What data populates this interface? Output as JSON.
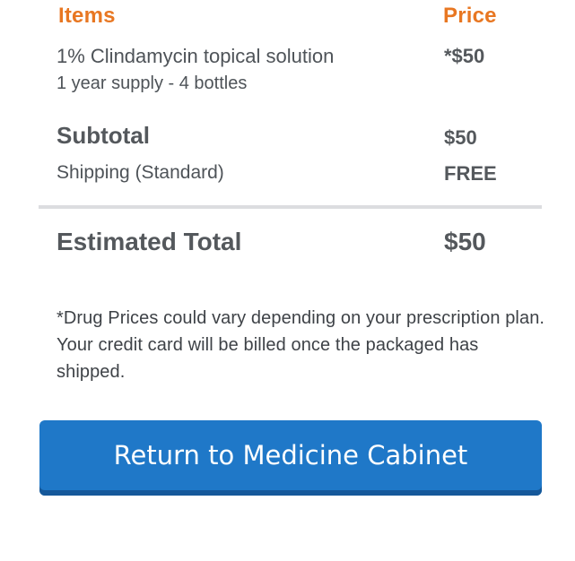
{
  "summary": {
    "header": {
      "items_label": "Items",
      "price_label": "Price"
    },
    "item": {
      "name": "1% Clindamycin topical solution",
      "detail": "1 year supply - 4 bottles",
      "price": "*$50"
    },
    "subtotal": {
      "label": "Subtotal",
      "value": "$50"
    },
    "shipping": {
      "label": "Shipping (Standard)",
      "value": "FREE"
    },
    "total": {
      "label": "Estimated Total",
      "value": "$50"
    }
  },
  "disclaimer": "*Drug Prices could vary depending on your prescription plan. Your credit card will be billed once the packaged has shipped.",
  "actions": {
    "return_label": "Return to Medicine Cabinet"
  },
  "colors": {
    "accent": "#e87722",
    "button": "#1f78c8",
    "text": "#54585c"
  }
}
